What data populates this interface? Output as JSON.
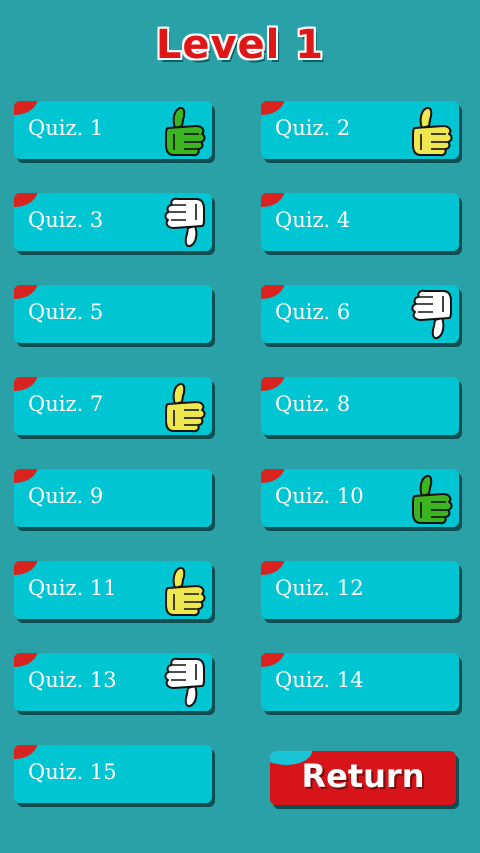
{
  "title": "Level 1",
  "colors": {
    "background": "#2aa1a6",
    "tile": "#00c6d4",
    "corner": "#d9231f",
    "title": "#e11616",
    "return": "#d6141a",
    "thumb_green": "#3cb521",
    "thumb_yellow": "#eee84e",
    "thumb_white": "#ffffff"
  },
  "quizzes": [
    {
      "label": "Quiz. 1",
      "icon": "thumbs-up-green-icon"
    },
    {
      "label": "Quiz. 2",
      "icon": "thumbs-up-yellow-icon"
    },
    {
      "label": "Quiz. 3",
      "icon": "thumbs-down-white-icon"
    },
    {
      "label": "Quiz. 4",
      "icon": ""
    },
    {
      "label": "Quiz. 5",
      "icon": ""
    },
    {
      "label": "Quiz. 6",
      "icon": "thumbs-down-white-icon"
    },
    {
      "label": "Quiz. 7",
      "icon": "thumbs-up-yellow-icon"
    },
    {
      "label": "Quiz. 8",
      "icon": ""
    },
    {
      "label": "Quiz. 9",
      "icon": ""
    },
    {
      "label": "Quiz. 10",
      "icon": "thumbs-up-green-icon"
    },
    {
      "label": "Quiz. 11",
      "icon": "thumbs-up-yellow-icon"
    },
    {
      "label": "Quiz. 12",
      "icon": ""
    },
    {
      "label": "Quiz. 13",
      "icon": "thumbs-down-white-icon"
    },
    {
      "label": "Quiz. 14",
      "icon": ""
    },
    {
      "label": "Quiz. 15",
      "icon": ""
    }
  ],
  "return_label": "Return"
}
